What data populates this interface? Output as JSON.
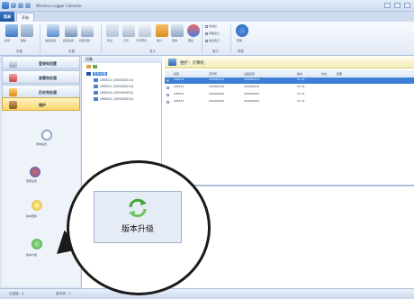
{
  "window": {
    "title": "Wireless Logger Collector"
  },
  "tabs": {
    "menu": "菜单",
    "start": "开始"
  },
  "ribbon": {
    "buttons": [
      "新增",
      "删除",
      "编辑设备",
      "批量设置",
      "批量清除",
      "导出",
      "打印",
      "打印预览",
      "统计",
      "查看",
      "属性",
      "帮助"
    ],
    "groups": [
      "设备",
      "设置",
      "显示",
      "窗口",
      "帮助"
    ],
    "checks": [
      "状态栏",
      "导航窗口",
      "信息窗口"
    ]
  },
  "nav": {
    "items": [
      "登录和设置",
      "查看和处理",
      "历史和处理",
      "维护"
    ],
    "active_index": 3,
    "sub_items": [
      "时钟设置",
      "测量设置",
      "版本更新",
      "版本升级"
    ]
  },
  "tree": {
    "header": "设备",
    "root": "所有设备",
    "devices": [
      "LR8512 (200000214)",
      "LR8512 (200000210)",
      "LR8514 (200000402)",
      "LR8515 (200000552)"
    ]
  },
  "main": {
    "title": "维护：计算机",
    "columns": [
      "机型",
      "序列号",
      "设备名称",
      "版本",
      "状态",
      "结果"
    ],
    "rows": [
      {
        "model": "LR8512",
        "serial": "200000214",
        "name": "200000214",
        "version": "V1.31"
      },
      {
        "model": "LR8512",
        "serial": "200000210",
        "name": "200000210",
        "version": "V1.31"
      },
      {
        "model": "LR8514",
        "serial": "200000402",
        "name": "200000402",
        "version": "V1.31"
      },
      {
        "model": "LR8515",
        "serial": "200000552",
        "name": "200000552",
        "version": "V1.31"
      }
    ],
    "selected_row": 0
  },
  "status": {
    "left": "已连接：4",
    "mid": "选中项：1"
  },
  "callout": {
    "label": "版本升级",
    "icon": "refresh-icon"
  },
  "colors": {
    "accent": "#3d7fd6",
    "active_nav": "#fbd66d",
    "upgrade_green": "#3fa535"
  }
}
